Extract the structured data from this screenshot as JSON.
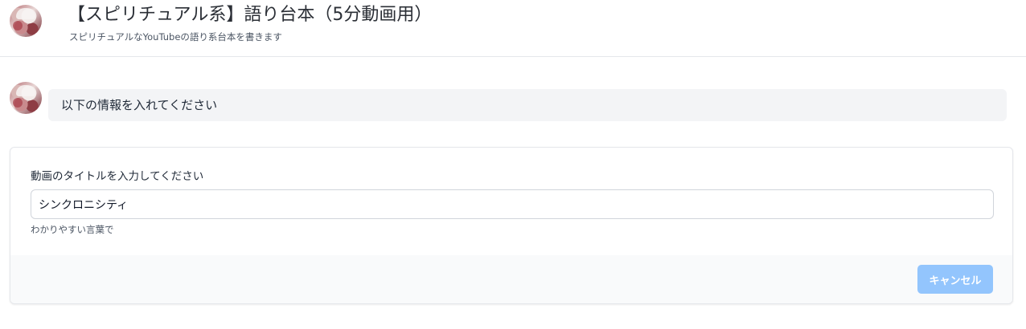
{
  "header": {
    "avatar_icon": "user-avatar-icon",
    "title": "【スピリチュアル系】語り台本（5分動画用）",
    "subtitle": "スピリチュアルなYouTubeの語り系台本を書きます"
  },
  "chat": {
    "avatar_icon": "assistant-avatar-icon",
    "message": "以下の情報を入れてください"
  },
  "form": {
    "field_label": "動画のタイトルを入力してください",
    "input_value": "シンクロニシティ",
    "hint": "わかりやすい言葉で",
    "cancel_label": "キャンセル"
  },
  "colors": {
    "button_bg": "#93c5fd",
    "bubble_bg": "#f3f4f6",
    "footer_bg": "#f9fafb",
    "border": "#e5e7eb"
  }
}
